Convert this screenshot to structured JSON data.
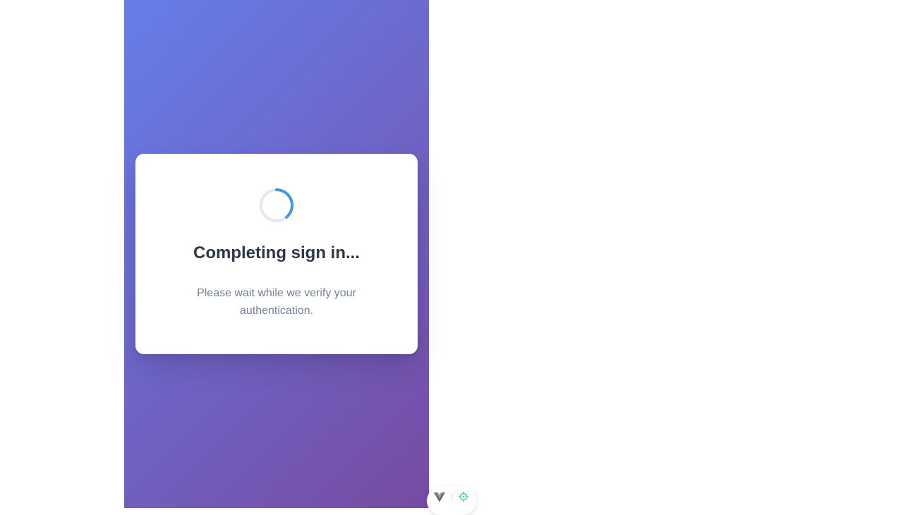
{
  "auth_callback": {
    "title": "Completing sign in...",
    "message": "Please wait while we verify your authentication."
  },
  "theme": {
    "gradient_start": "#667eea",
    "gradient_end": "#764ba2",
    "spinner_track": "#e2e8f0",
    "spinner_accent": "#4299e1"
  },
  "devtools": {
    "icons": [
      "vue-logo-icon",
      "target-icon"
    ]
  }
}
